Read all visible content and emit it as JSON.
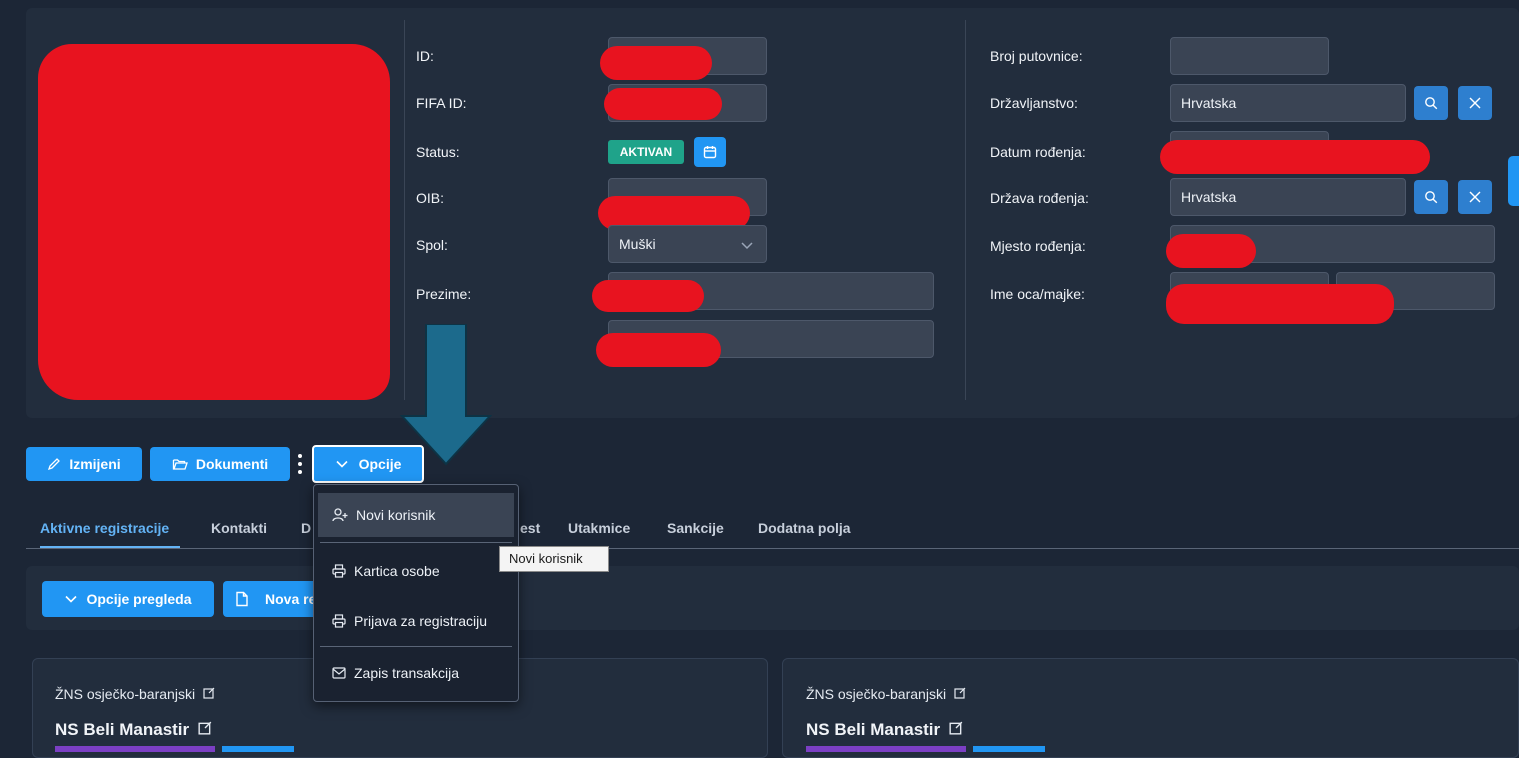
{
  "profile": {
    "fields_left": {
      "id_label": "ID:",
      "fifa_label": "FIFA ID:",
      "status_label": "Status:",
      "status_value": "AKTIVAN",
      "oib_label": "OIB:",
      "spol_label": "Spol:",
      "spol_value": "Muški",
      "prezime_label": "Prezime:"
    },
    "fields_right": {
      "passport_label": "Broj putovnice:",
      "citizenship_label": "Državljanstvo:",
      "citizenship_value": "Hrvatska",
      "dob_label": "Datum rođenja:",
      "birth_country_label": "Država rođenja:",
      "birth_country_value": "Hrvatska",
      "birthplace_label": "Mjesto rođenja:",
      "parent_label": "Ime oca/majke:"
    }
  },
  "toolbar": {
    "edit_label": "Izmijeni",
    "documents_label": "Dokumenti",
    "options_label": "Opcije"
  },
  "tabs": {
    "active": "Aktivne registracije",
    "contacts": "Kontakti",
    "partial_d": "D",
    "partial_est": "est",
    "matches": "Utakmice",
    "sanctions": "Sankcije",
    "extra_fields": "Dodatna polja"
  },
  "subtoolbar": {
    "view_options_label": "Opcije pregleda",
    "new_partial_label": "Nova re"
  },
  "dropdown": {
    "new_user": "Novi korisnik",
    "person_card": "Kartica osobe",
    "registration_form": "Prijava za registraciju",
    "transaction_log": "Zapis transakcija",
    "tooltip": "Novi korisnik"
  },
  "cards": [
    {
      "federation": "ŽNS osječko-baranjski",
      "club": "NS Beli Manastir"
    },
    {
      "federation": "ŽNS osječko-baranjski",
      "club": "NS Beli Manastir"
    }
  ],
  "colors": {
    "accent": "#2196f3",
    "status_badge": "#1fa38a",
    "redaction": "#e8131f",
    "arrow": "#1c6a8c"
  }
}
